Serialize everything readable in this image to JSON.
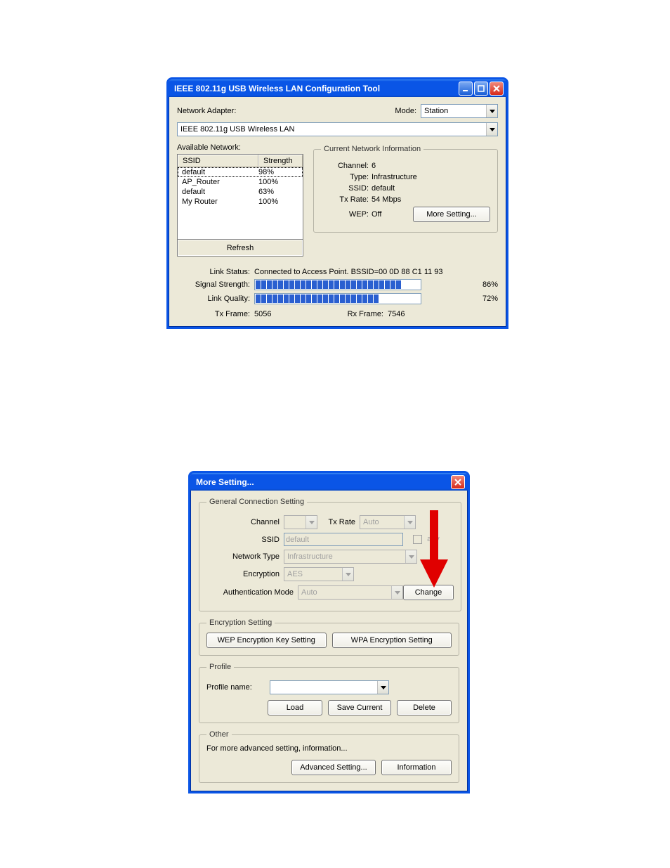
{
  "win1": {
    "title": "IEEE 802.11g USB Wireless LAN Configuration Tool",
    "network_adapter_label": "Network Adapter:",
    "mode_label": "Mode:",
    "mode_value": "Station",
    "adapter_value": "IEEE 802.11g USB Wireless LAN",
    "available_network_label": "Available Network:",
    "columns": {
      "ssid": "SSID",
      "strength": "Strength"
    },
    "networks": [
      {
        "ssid": "default",
        "strength": "98%",
        "selected": true
      },
      {
        "ssid": "AP_Router",
        "strength": "100%",
        "selected": false
      },
      {
        "ssid": "default",
        "strength": "63%",
        "selected": false
      },
      {
        "ssid": "My Router",
        "strength": "100%",
        "selected": false
      }
    ],
    "refresh_label": "Refresh",
    "current_info_group": "Current Network Information",
    "info": {
      "channel_k": "Channel:",
      "channel_v": "6",
      "type_k": "Type:",
      "type_v": "Infrastructure",
      "ssid_k": "SSID:",
      "ssid_v": "default",
      "txrate_k": "Tx Rate:",
      "txrate_v": "54 Mbps",
      "wep_k": "WEP:",
      "wep_v": "Off"
    },
    "more_setting_label": "More Setting...",
    "link_status_k": "Link Status:",
    "link_status_v": "Connected to Access Point. BSSID=00 0D 88 C1 11 93",
    "signal_strength_k": "Signal Strength:",
    "signal_strength_pct": "86%",
    "signal_segments": 26,
    "link_quality_k": "Link Quality:",
    "link_quality_pct": "72%",
    "quality_segments": 22,
    "tx_frame_k": "Tx Frame:",
    "tx_frame_v": "5056",
    "rx_frame_k": "Rx Frame:",
    "rx_frame_v": "7546"
  },
  "win2": {
    "title": "More Setting...",
    "groups": {
      "general": "General Connection Setting",
      "encryption": "Encryption Setting",
      "profile": "Profile",
      "other": "Other"
    },
    "general": {
      "channel_label": "Channel",
      "channel_value": "",
      "txrate_label": "Tx Rate",
      "txrate_value": "Auto",
      "ssid_label": "SSID",
      "ssid_value": "default",
      "any_label": "any",
      "nettype_label": "Network Type",
      "nettype_value": "Infrastructure",
      "enc_label": "Encryption",
      "enc_value": "AES",
      "auth_label": "Authentication Mode",
      "auth_value": "Auto",
      "change_label": "Change"
    },
    "encryption": {
      "wep_btn": "WEP Encryption Key Setting",
      "wpa_btn": "WPA Encryption Setting"
    },
    "profile": {
      "name_label": "Profile name:",
      "name_value": "",
      "load": "Load",
      "save": "Save Current",
      "del": "Delete"
    },
    "other": {
      "text": "For more advanced setting, information...",
      "adv": "Advanced Setting...",
      "info": "Information"
    }
  }
}
